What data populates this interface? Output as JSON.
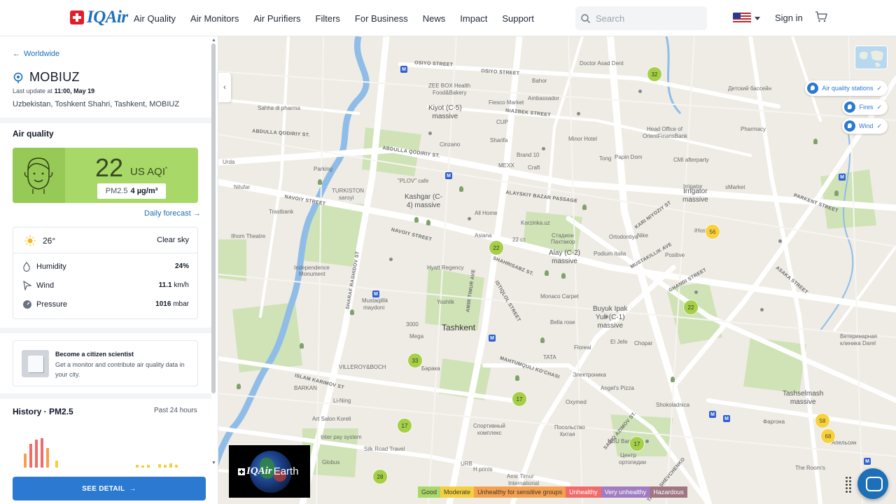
{
  "nav": {
    "brand": "IQAir",
    "items": [
      "Air Quality",
      "Air Monitors",
      "Air Purifiers",
      "Filters",
      "For Business",
      "News",
      "Impact",
      "Support"
    ],
    "search_placeholder": "Search",
    "signin": "Sign in"
  },
  "panel": {
    "back_label": "Worldwide",
    "station_name": "MOBIUZ",
    "last_update_prefix": "Last update at",
    "last_update_time": "11:00, May 19",
    "location": "Uzbekistan, Toshkent Shahri, Tashkent, MOBIUZ",
    "air_quality_title": "Air quality",
    "aqi": {
      "value": "22",
      "unit": "US AQI",
      "unit_mark": "*",
      "pollutant": "PM2.5",
      "concentration": "4 µg/m³",
      "color": "#a8d868"
    },
    "forecast_label": "Daily forecast",
    "weather": {
      "temp": "26°",
      "condition": "Clear sky",
      "rows": [
        {
          "label": "Humidity",
          "value": "24%",
          "unit": ""
        },
        {
          "label": "Wind",
          "value": "11.1",
          "unit": "km/h"
        },
        {
          "label": "Pressure",
          "value": "1016",
          "unit": "mbar"
        }
      ]
    },
    "citizen": {
      "title": "Become a citizen scientist",
      "text": "Get a monitor and contribute air quality data in your city."
    },
    "history": {
      "title": "History",
      "pollutant": "PM2.5",
      "range": "Past 24 hours"
    },
    "see_detail": "SEE DETAIL"
  },
  "map": {
    "layers": [
      {
        "label": "Air quality stations"
      },
      {
        "label": "Fires"
      },
      {
        "label": "Wind"
      }
    ],
    "markers": [
      "32",
      "22",
      "56",
      "22",
      "33",
      "17",
      "17",
      "17",
      "28",
      "58",
      "68"
    ],
    "city_label": "Tashkent",
    "districts": [
      "Kiyot (C-5)",
      "massive",
      "Kashgar (C-",
      "4) massive",
      "Alay (C-2)",
      "massive",
      "Buyuk Ipak",
      "Yuli (C-1)",
      "massive",
      "Irrigator",
      "massive",
      "Tashselmash",
      "massive"
    ],
    "streets": [
      "ABDULLA QODIRIY ST.",
      "ABDULLA QODIRIY ST.",
      "NAVOIY STREET",
      "NAVOIY STREET",
      "SHAHRISABZ ST.",
      "AMIR TIMUR AVE",
      "MUSTAKILLIK AVE",
      "KARI NIYOZIY ST",
      "ISTIQLOL STREET",
      "PARKENT STREET",
      "OSIYO STREET",
      "OSIYO STREET",
      "NIAZBEK STREET",
      "ALAYSKIY BAZAR PASSAGE",
      "MAHTUMQULI KO'CHASI",
      "ISLAM KARIMOV ST",
      "SHARAF RASHIDOV ST",
      "GHANDI STREET",
      "ASAKA STREET",
      "SADIQ AZIMOV ST.",
      "TARAS SHEVCHENKO"
    ],
    "places": [
      "Doctor Asad Dent",
      "Sahha di pharma",
      "ZEE BOX Health",
      "Food&Bakery",
      "Fiesco Market",
      "Bahor",
      "Ambassador",
      "CUP",
      "Sharifa",
      "Cinzano",
      "Brand 10",
      "MEXX",
      "Craft",
      "Minor Hotel",
      "Tong",
      "Papin Dom",
      "CMI afterparty",
      "Head Office of",
      "OrientFinansBank",
      "Pharmacy",
      "\"PLOV\" cafe",
      "TURKISTON",
      "saroyi",
      "Trastbank",
      "Ilhom Theatre",
      "All Home",
      "Asiana",
      "22 ст",
      "Hyatt Regency",
      "Independence",
      "Monument",
      "Mustaqillik",
      "maydoni",
      "Yoshlik",
      "3000",
      "Mega",
      "Барака",
      "VILLEROY&BOCH",
      "Monaco Carpet",
      "Bella rose",
      "Floreal",
      "El Jefe",
      "Chopar",
      "TATA",
      "Электроника",
      "Angel's Pizza",
      "Oxymed",
      "Shokoladnica",
      "Li-Ning",
      "Art Salon Koreli",
      "Inter pay system",
      "Silk Road Travel",
      "Globus",
      "Спортивный",
      "комплекс",
      "Посольство",
      "Китая",
      "NBU Bank",
      "Центр",
      "ортопедии",
      "URB",
      "H prints",
      "Amir Timur",
      "International",
      "Positive",
      "Nike",
      "Podium Italia",
      "Ortodontiya",
      "Korzinka.uz",
      "Стадион",
      "Пахтакор",
      "Urda",
      "Nilufar",
      "BARKAN",
      "Parking",
      "Детский бассейн",
      "Ветеринарная",
      "клиника Darel",
      "Фаргона",
      "Апельсин",
      "The Room's",
      "sMarket",
      "Irrigator",
      "iHostel"
    ],
    "earth_label_brand": "IQAir",
    "earth_label_word": "Earth"
  },
  "legend": [
    {
      "label": "Good",
      "color": "#a8d868"
    },
    {
      "label": "Moderate",
      "color": "#f4d03f"
    },
    {
      "label": "Unhealthy for sensitive groups",
      "color": "#f6a04d"
    },
    {
      "label": "Unhealthy",
      "color": "#f26b6b"
    },
    {
      "label": "Very unhealthy",
      "color": "#a17cc2"
    },
    {
      "label": "Hazardous",
      "color": "#a07684"
    }
  ]
}
